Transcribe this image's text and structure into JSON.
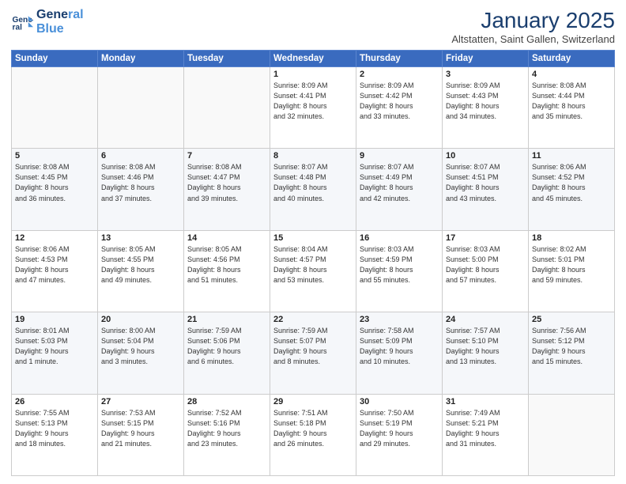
{
  "header": {
    "logo_line1": "General",
    "logo_line2": "Blue",
    "title": "January 2025",
    "subtitle": "Altstatten, Saint Gallen, Switzerland"
  },
  "days_of_week": [
    "Sunday",
    "Monday",
    "Tuesday",
    "Wednesday",
    "Thursday",
    "Friday",
    "Saturday"
  ],
  "weeks": [
    [
      {
        "day": "",
        "info": ""
      },
      {
        "day": "",
        "info": ""
      },
      {
        "day": "",
        "info": ""
      },
      {
        "day": "1",
        "info": "Sunrise: 8:09 AM\nSunset: 4:41 PM\nDaylight: 8 hours\nand 32 minutes."
      },
      {
        "day": "2",
        "info": "Sunrise: 8:09 AM\nSunset: 4:42 PM\nDaylight: 8 hours\nand 33 minutes."
      },
      {
        "day": "3",
        "info": "Sunrise: 8:09 AM\nSunset: 4:43 PM\nDaylight: 8 hours\nand 34 minutes."
      },
      {
        "day": "4",
        "info": "Sunrise: 8:08 AM\nSunset: 4:44 PM\nDaylight: 8 hours\nand 35 minutes."
      }
    ],
    [
      {
        "day": "5",
        "info": "Sunrise: 8:08 AM\nSunset: 4:45 PM\nDaylight: 8 hours\nand 36 minutes."
      },
      {
        "day": "6",
        "info": "Sunrise: 8:08 AM\nSunset: 4:46 PM\nDaylight: 8 hours\nand 37 minutes."
      },
      {
        "day": "7",
        "info": "Sunrise: 8:08 AM\nSunset: 4:47 PM\nDaylight: 8 hours\nand 39 minutes."
      },
      {
        "day": "8",
        "info": "Sunrise: 8:07 AM\nSunset: 4:48 PM\nDaylight: 8 hours\nand 40 minutes."
      },
      {
        "day": "9",
        "info": "Sunrise: 8:07 AM\nSunset: 4:49 PM\nDaylight: 8 hours\nand 42 minutes."
      },
      {
        "day": "10",
        "info": "Sunrise: 8:07 AM\nSunset: 4:51 PM\nDaylight: 8 hours\nand 43 minutes."
      },
      {
        "day": "11",
        "info": "Sunrise: 8:06 AM\nSunset: 4:52 PM\nDaylight: 8 hours\nand 45 minutes."
      }
    ],
    [
      {
        "day": "12",
        "info": "Sunrise: 8:06 AM\nSunset: 4:53 PM\nDaylight: 8 hours\nand 47 minutes."
      },
      {
        "day": "13",
        "info": "Sunrise: 8:05 AM\nSunset: 4:55 PM\nDaylight: 8 hours\nand 49 minutes."
      },
      {
        "day": "14",
        "info": "Sunrise: 8:05 AM\nSunset: 4:56 PM\nDaylight: 8 hours\nand 51 minutes."
      },
      {
        "day": "15",
        "info": "Sunrise: 8:04 AM\nSunset: 4:57 PM\nDaylight: 8 hours\nand 53 minutes."
      },
      {
        "day": "16",
        "info": "Sunrise: 8:03 AM\nSunset: 4:59 PM\nDaylight: 8 hours\nand 55 minutes."
      },
      {
        "day": "17",
        "info": "Sunrise: 8:03 AM\nSunset: 5:00 PM\nDaylight: 8 hours\nand 57 minutes."
      },
      {
        "day": "18",
        "info": "Sunrise: 8:02 AM\nSunset: 5:01 PM\nDaylight: 8 hours\nand 59 minutes."
      }
    ],
    [
      {
        "day": "19",
        "info": "Sunrise: 8:01 AM\nSunset: 5:03 PM\nDaylight: 9 hours\nand 1 minute."
      },
      {
        "day": "20",
        "info": "Sunrise: 8:00 AM\nSunset: 5:04 PM\nDaylight: 9 hours\nand 3 minutes."
      },
      {
        "day": "21",
        "info": "Sunrise: 7:59 AM\nSunset: 5:06 PM\nDaylight: 9 hours\nand 6 minutes."
      },
      {
        "day": "22",
        "info": "Sunrise: 7:59 AM\nSunset: 5:07 PM\nDaylight: 9 hours\nand 8 minutes."
      },
      {
        "day": "23",
        "info": "Sunrise: 7:58 AM\nSunset: 5:09 PM\nDaylight: 9 hours\nand 10 minutes."
      },
      {
        "day": "24",
        "info": "Sunrise: 7:57 AM\nSunset: 5:10 PM\nDaylight: 9 hours\nand 13 minutes."
      },
      {
        "day": "25",
        "info": "Sunrise: 7:56 AM\nSunset: 5:12 PM\nDaylight: 9 hours\nand 15 minutes."
      }
    ],
    [
      {
        "day": "26",
        "info": "Sunrise: 7:55 AM\nSunset: 5:13 PM\nDaylight: 9 hours\nand 18 minutes."
      },
      {
        "day": "27",
        "info": "Sunrise: 7:53 AM\nSunset: 5:15 PM\nDaylight: 9 hours\nand 21 minutes."
      },
      {
        "day": "28",
        "info": "Sunrise: 7:52 AM\nSunset: 5:16 PM\nDaylight: 9 hours\nand 23 minutes."
      },
      {
        "day": "29",
        "info": "Sunrise: 7:51 AM\nSunset: 5:18 PM\nDaylight: 9 hours\nand 26 minutes."
      },
      {
        "day": "30",
        "info": "Sunrise: 7:50 AM\nSunset: 5:19 PM\nDaylight: 9 hours\nand 29 minutes."
      },
      {
        "day": "31",
        "info": "Sunrise: 7:49 AM\nSunset: 5:21 PM\nDaylight: 9 hours\nand 31 minutes."
      },
      {
        "day": "",
        "info": ""
      }
    ]
  ]
}
